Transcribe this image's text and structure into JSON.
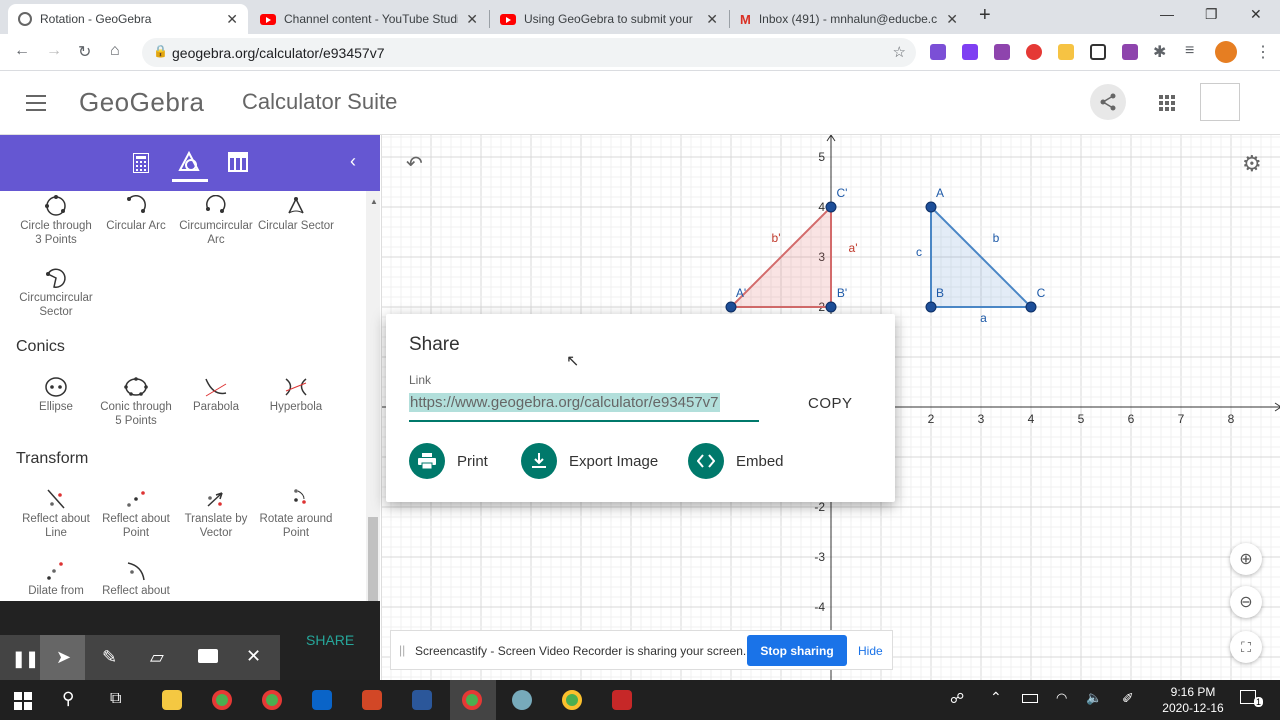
{
  "browser": {
    "tabs": [
      {
        "title": "Rotation - GeoGebra",
        "icon": "geogebra-icon"
      },
      {
        "title": "Channel content - YouTube Studi",
        "icon": "youtube-icon"
      },
      {
        "title": "Using GeoGebra to submit your",
        "icon": "youtube-icon"
      },
      {
        "title": "Inbox (491) - mnhalun@educbe.c",
        "icon": "gmail-icon"
      }
    ],
    "url": "geogebra.org/calculator/e93457v7"
  },
  "app": {
    "logo": "GeoGebra",
    "title": "Calculator Suite",
    "accent": "#6557d2"
  },
  "tools": {
    "row1": [
      {
        "label": "Circle through 3 Points"
      },
      {
        "label": "Circular Arc"
      },
      {
        "label": "Circumcircular Arc"
      },
      {
        "label": "Circular Sector"
      }
    ],
    "row2": [
      {
        "label": "Circumcircular Sector"
      }
    ],
    "conics_heading": "Conics",
    "conics": [
      {
        "label": "Ellipse"
      },
      {
        "label": "Conic through 5 Points"
      },
      {
        "label": "Parabola"
      },
      {
        "label": "Hyperbola"
      }
    ],
    "transform_heading": "Transform",
    "transform": [
      {
        "label": "Reflect about Line"
      },
      {
        "label": "Reflect about Point"
      },
      {
        "label": "Translate by Vector"
      },
      {
        "label": "Rotate around Point"
      }
    ],
    "transform2": [
      {
        "label": "Dilate from"
      },
      {
        "label": "Reflect about"
      }
    ]
  },
  "graph": {
    "x_ticks": [
      "2",
      "3",
      "4",
      "5",
      "6",
      "7",
      "8"
    ],
    "y_ticks": [
      "5",
      "4",
      "3",
      "2",
      "-2",
      "-3",
      "-4"
    ],
    "triangle": {
      "A": "A",
      "B": "B",
      "C": "C",
      "a": "a",
      "b": "b",
      "c": "c"
    },
    "image": {
      "A": "A'",
      "B": "B'",
      "C": "C'",
      "a": "a'",
      "b": "b'"
    }
  },
  "dialog": {
    "title": "Share",
    "link_label": "Link",
    "link": "https://www.geogebra.org/calculator/e93457v7",
    "copy": "COPY",
    "print": "Print",
    "export": "Export Image",
    "embed": "Embed"
  },
  "recorder": {
    "share_label": "SHARE",
    "notice": "Screencastify - Screen Video Recorder is sharing your screen.",
    "stop": "Stop sharing",
    "hide": "Hide"
  },
  "taskbar": {
    "time": "9:16 PM",
    "date": "2020-12-16",
    "notifications": "1"
  }
}
